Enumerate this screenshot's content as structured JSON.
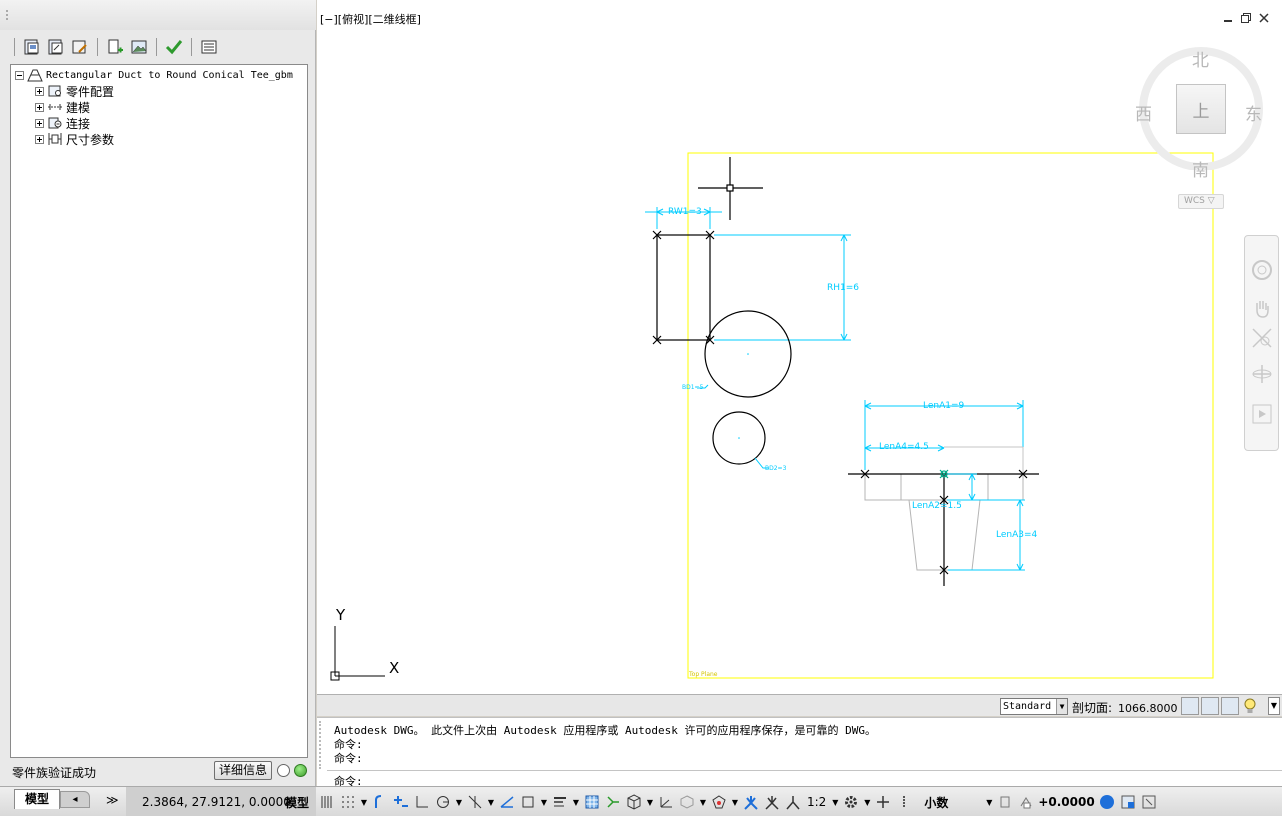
{
  "palette": {
    "tree": {
      "root": "Rectangular Duct to Round Conical Tee_gbm",
      "children": [
        {
          "label": "零件配置",
          "icon": "part-config-icon"
        },
        {
          "label": "建模",
          "icon": "modeling-icon"
        },
        {
          "label": "连接",
          "icon": "connection-icon"
        },
        {
          "label": "尺寸参数",
          "icon": "dimension-params-icon"
        }
      ]
    },
    "status_message": "零件族验证成功",
    "details_button": "详细信息"
  },
  "viewport": {
    "label": "[−][俯视][二维线框]",
    "viewcube": {
      "north": "北",
      "south": "南",
      "east": "东",
      "west": "西",
      "face": "上",
      "wcs": "WCS ▽"
    },
    "ucs": {
      "x": "X",
      "y": "Y"
    },
    "dimensions": {
      "rw1": "RW1=3",
      "rh1": "RH1=6",
      "lena1": "LenA1=9",
      "lena4": "LenA4=4.5",
      "lena2": "LenA2=1.5",
      "lena3": "LenA3=4",
      "small1": "BD1=5",
      "small2": "BD2=3",
      "frame": "Top Plane"
    }
  },
  "layout_strip": {
    "text_style": "Standard",
    "section_label": "剖切面:",
    "section_value": "1066.8000"
  },
  "command": {
    "history": [
      "Autodesk DWG。  此文件上次由 Autodesk 应用程序或 Autodesk 许可的应用程序保存，是可靠的 DWG。",
      "命令:",
      "命令:"
    ],
    "prompt": "命令:"
  },
  "statusbar": {
    "tab_model": "模型",
    "tab_layout": "◂",
    "coordinates": "2.3864, 27.9121, 0.0000",
    "space": "模型",
    "scale": "1:2",
    "units": "小数",
    "offset": "+0.0000"
  },
  "colors": {
    "dimension": "#00ccff",
    "frame": "#ffff00",
    "geometry": "#000000",
    "inactive": "#9a9a9a",
    "point_marker": "#00aa88"
  }
}
